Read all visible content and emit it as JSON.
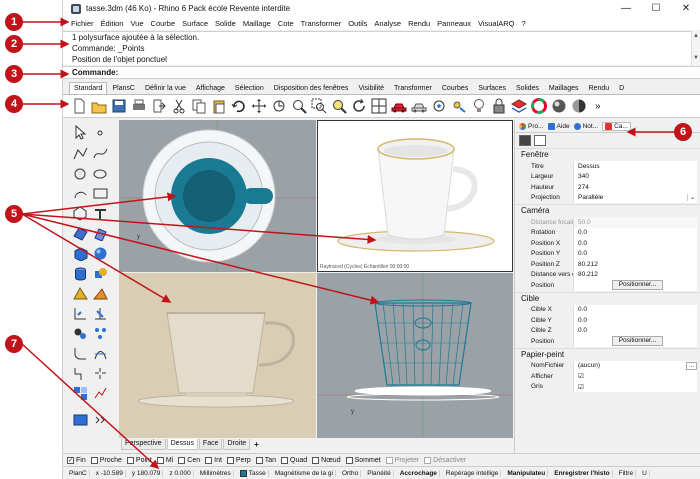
{
  "window": {
    "title": "tasse.3dm (46 Ko) - Rhino 6 Pack école Revente interdite",
    "controls": [
      "—",
      "☐",
      "✕"
    ]
  },
  "menu": [
    "Fichier",
    "Édition",
    "Vue",
    "Courbe",
    "Surface",
    "Solide",
    "Maillage",
    "Cote",
    "Transformer",
    "Outils",
    "Analyse",
    "Rendu",
    "Panneaux",
    "VisualARQ",
    "?"
  ],
  "command_history": [
    "1 polysurface ajoutée à la sélection.",
    "Commande: _Points",
    "Position de l'objet ponctuel"
  ],
  "command_prompt": "Commande:",
  "toolbar_tabs": [
    "Standard",
    "PlansC",
    "Définir la vue",
    "Affichage",
    "Sélection",
    "Disposition des fenêtres",
    "Visibilité",
    "Transformer",
    "Courbes",
    "Surfaces",
    "Solides",
    "Maillages",
    "Rendu",
    "D"
  ],
  "toolbar_overflow": "»",
  "viewport_tabs": [
    "Perspective",
    "Dessus",
    "Face",
    "Droite"
  ],
  "viewport_add": "+",
  "viewport_persp_caption": "Raytraced (Cycles)   Échantillon   00:00:00",
  "right_panel": {
    "tabs": [
      "Pro...",
      "Aide",
      "Not...",
      "Ca..."
    ],
    "fenetre": {
      "header": "Fenêtre",
      "rows": [
        {
          "k": "Titre",
          "v": "Dessus"
        },
        {
          "k": "Largeur",
          "v": "340"
        },
        {
          "k": "Hauteur",
          "v": "274"
        },
        {
          "k": "Projection",
          "v": "Parallèle"
        }
      ]
    },
    "camera": {
      "header": "Caméra",
      "rows": [
        {
          "k": "Distance focale",
          "v": "50.0"
        },
        {
          "k": "Rotation",
          "v": "0.0"
        },
        {
          "k": "Position X",
          "v": "0.0"
        },
        {
          "k": "Position Y",
          "v": "0.0"
        },
        {
          "k": "Position Z",
          "v": "80.212"
        },
        {
          "k": "Distance vers ci...",
          "v": "80.212"
        },
        {
          "k": "Position",
          "v": "Positionner..."
        }
      ]
    },
    "cible": {
      "header": "Cible",
      "rows": [
        {
          "k": "Cible X",
          "v": "0.0"
        },
        {
          "k": "Cible Y",
          "v": "0.0"
        },
        {
          "k": "Cible Z",
          "v": "0.0"
        },
        {
          "k": "Position",
          "v": "Positionner..."
        }
      ]
    },
    "papier": {
      "header": "Papier-peint",
      "rows": [
        {
          "k": "NomFichier",
          "v": "(aucun)"
        },
        {
          "k": "Afficher",
          "v": "☑"
        },
        {
          "k": "Gris",
          "v": "☑"
        }
      ]
    }
  },
  "osnaps": [
    {
      "label": "Fin",
      "checked": "✓"
    },
    {
      "label": "Proche",
      "checked": ""
    },
    {
      "label": "Point",
      "checked": ""
    },
    {
      "label": "Mi",
      "checked": ""
    },
    {
      "label": "Cen",
      "checked": ""
    },
    {
      "label": "Int",
      "checked": ""
    },
    {
      "label": "Perp",
      "checked": ""
    },
    {
      "label": "Tan",
      "checked": ""
    },
    {
      "label": "Quad",
      "checked": ""
    },
    {
      "label": "Nœud",
      "checked": ""
    },
    {
      "label": "Sommet",
      "checked": ""
    },
    {
      "label": "Projeter",
      "checked": ""
    },
    {
      "label": "Désactiver",
      "checked": ""
    }
  ],
  "status": {
    "plan": "PlanC",
    "x": "x -10.589",
    "y": "y 180.079",
    "z": "z 0.000",
    "units": "Millimètres",
    "layer": "Tasse",
    "items": [
      "Magnétisme de la gi",
      "Ortho",
      "Planéité",
      "Accrochage",
      "Repérage intellige",
      "Manipulateu",
      "Enregistrer l'histo",
      "Filtre",
      "U"
    ]
  },
  "callouts": [
    "1",
    "2",
    "3",
    "4",
    "5",
    "6",
    "7"
  ],
  "colors": {
    "callout": "#c0141a",
    "cup_teal": "#1b7a93",
    "viewport_gray": "#9aa2a8",
    "front_bg": "#d9cdb4"
  }
}
